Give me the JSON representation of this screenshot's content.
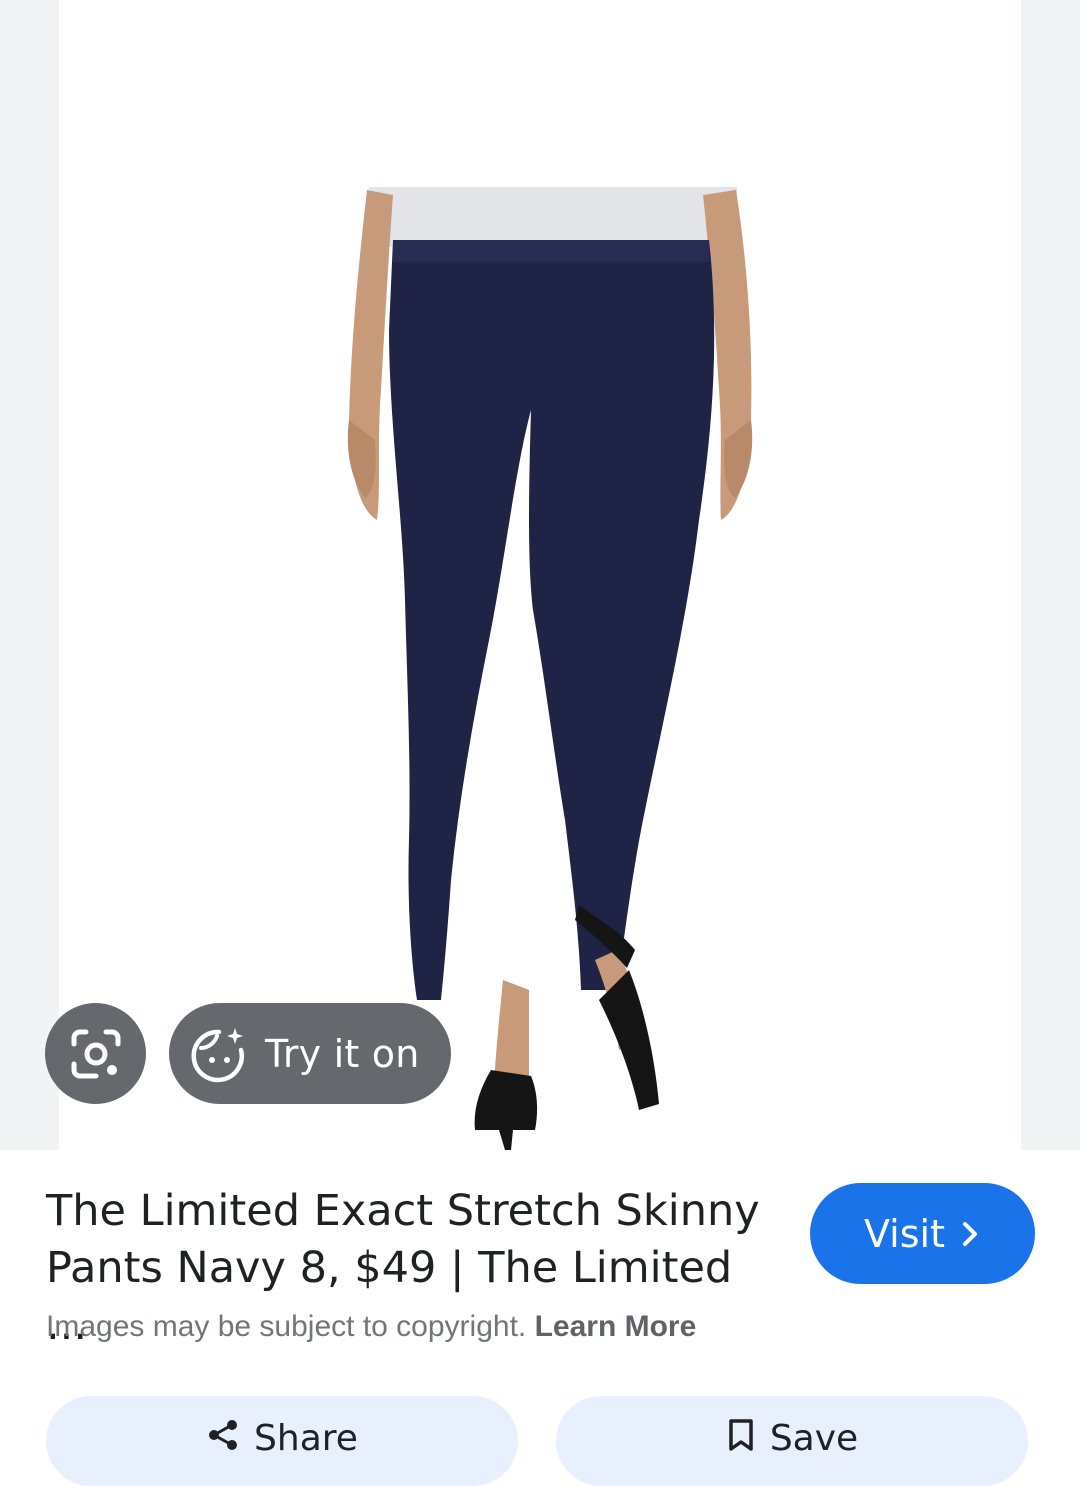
{
  "overlay": {
    "lens_icon": "google-lens-icon",
    "try_on_icon": "face-sparkle-icon",
    "try_on_label": "Try it on"
  },
  "product": {
    "title": "The Limited Exact Stretch Skinny Pants Navy 8, $49 | The Limited ...",
    "visit_label": "Visit",
    "visit_icon": "chevron-right-icon",
    "copyright_text": "Images may be subject to copyright.",
    "learn_more_label": "Learn More"
  },
  "actions": {
    "share_label": "Share",
    "share_icon": "share-icon",
    "save_label": "Save",
    "save_icon": "bookmark-icon"
  },
  "colors": {
    "accent": "#1a73e8",
    "pants": "#1f2447",
    "chip_bg": "#e8f0fe",
    "overlay_button": "#5f6368"
  }
}
